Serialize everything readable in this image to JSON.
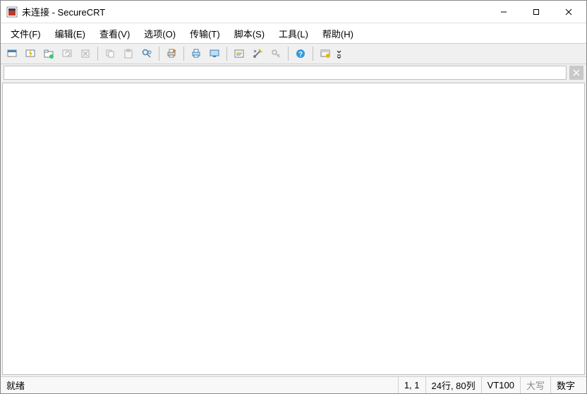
{
  "window": {
    "title": "未连接 - SecureCRT"
  },
  "menu": {
    "file": "文件(F)",
    "edit": "编辑(E)",
    "view": "查看(V)",
    "options": "选项(O)",
    "transfer": "传输(T)",
    "script": "脚本(S)",
    "tools": "工具(L)",
    "help": "帮助(H)"
  },
  "toolbar": {
    "connect": "connect-session",
    "quick": "quick-connect",
    "tabconnect": "connect-in-tab",
    "reconnect": "reconnect",
    "disconnect": "disconnect",
    "copy": "copy",
    "paste": "paste",
    "find": "find",
    "print": "print",
    "printsetup": "print-setup",
    "printscreen": "print-screen",
    "prefs": "session-options",
    "tools": "global-options",
    "key": "public-key",
    "helpBtn": "help",
    "toggle": "toggle-toolbar"
  },
  "status": {
    "ready": "就绪",
    "cursor": "1,   1",
    "size": "24行, 80列",
    "emulation": "VT100",
    "caps": "大写",
    "num": "数字"
  }
}
